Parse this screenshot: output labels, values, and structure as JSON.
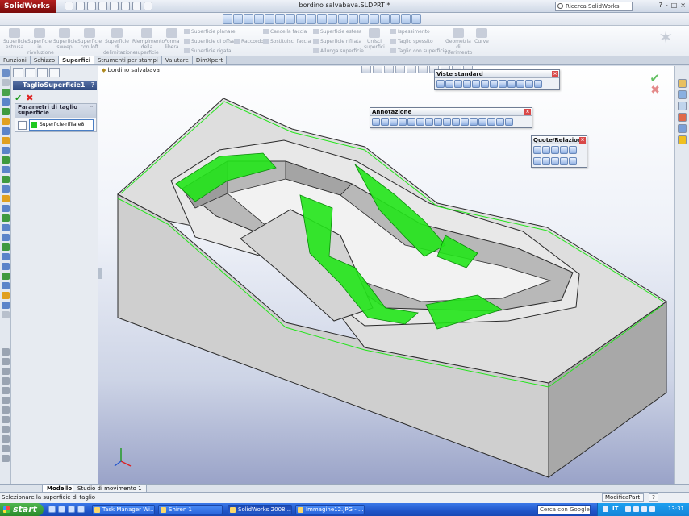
{
  "app": {
    "logo": "SolidWorks",
    "document_title": "bordino salvabava.SLDPRT *",
    "search_placeholder": "Ricerca SolidWorks",
    "window_buttons": [
      "?",
      "-",
      "□",
      "×"
    ]
  },
  "ribbon": {
    "large_items": [
      {
        "label": "Superficie estrusa"
      },
      {
        "label": "Superficie in rivoluzione"
      },
      {
        "label": "Superficie sweep"
      },
      {
        "label": "Superficie con loft"
      },
      {
        "label": "Superficie di delimitazione"
      },
      {
        "label": "Riempimento della superficie"
      },
      {
        "label": "Forma libera"
      },
      {
        "label": "Unisci superfici"
      },
      {
        "label": "Geometria di riferimento"
      },
      {
        "label": "Curve"
      }
    ],
    "small_items": [
      "Superficie planare",
      "Superficie di offset",
      "Superficie rigata",
      "Raccordo",
      "Cancella faccia",
      "Sostituisci faccia",
      "Superficie estesa",
      "Superficie rifilata",
      "Allunga superficie",
      "Ispessimento",
      "Taglio spessito",
      "Taglio con superficie"
    ]
  },
  "tabs": [
    {
      "label": "Funzioni",
      "active": false
    },
    {
      "label": "Schizzo",
      "active": false
    },
    {
      "label": "Superfici",
      "active": true
    },
    {
      "label": "Strumenti per stampi",
      "active": false
    },
    {
      "label": "Valutare",
      "active": false
    },
    {
      "label": "DimXpert",
      "active": false
    }
  ],
  "property_manager": {
    "title": "TaglioSuperficie1",
    "help": "?",
    "group_title": "Parametri di taglio superficie",
    "selection_value": "Superficie-rifilare8",
    "selection_color": "#20c820"
  },
  "viewport": {
    "tree_root": "bordino salvabava"
  },
  "floating_toolbars": {
    "standard_views": {
      "title": "Viste standard"
    },
    "annotation": {
      "title": "Annotazione"
    },
    "dimensions": {
      "title": "Quote/Relazioni"
    }
  },
  "bottom_tabs": [
    {
      "label": "Modello",
      "active": true
    },
    {
      "label": "Studio di movimento 1",
      "active": false
    }
  ],
  "status": {
    "message": "Selezionare la superficie di taglio",
    "mode": "ModificaPart",
    "help": "?"
  },
  "taskbar": {
    "start_label": "start",
    "windows": [
      {
        "label": "Task Manager Wi...",
        "active": false
      },
      {
        "label": "Shiren 1",
        "active": false
      },
      {
        "label": "SolidWorks 2008 ...",
        "active": true
      },
      {
        "label": "Immagine12.JPG - ...",
        "active": false
      }
    ],
    "search_placeholder": "Cerca con Google",
    "language": "IT",
    "clock": "13:31"
  },
  "colors": {
    "accent_green": "#22e61a",
    "model_gray": "#d8d8d8",
    "edge_dark": "#2a2a2a",
    "logo_red": "#a51515"
  }
}
